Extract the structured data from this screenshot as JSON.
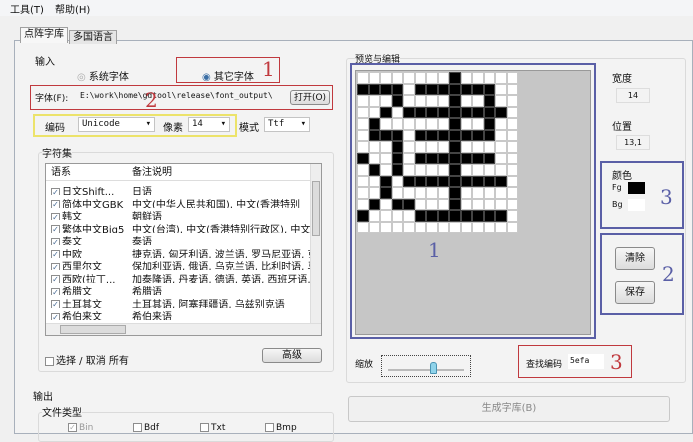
{
  "menu": {
    "tools": "工具(T)",
    "help": "帮助(H)"
  },
  "tabs": [
    "点阵字库",
    "多国语言"
  ],
  "input": {
    "title": "输入",
    "radio_system": "系统字体",
    "radio_other": "其它字体",
    "font_label": "字体(F):",
    "font_path": "E:\\work\\home\\gdtool\\release\\font_output\\",
    "open_button": "打开(O)",
    "encoding_label": "编码",
    "encoding_value": "Unicode",
    "pixel_label": "像素",
    "pixel_value": "14",
    "mode_label": "模式",
    "mode_value": "Ttf"
  },
  "charset": {
    "title": "字符集",
    "headers": [
      "语系",
      "备注说明"
    ],
    "rows": [
      [
        "日文Shift...",
        "日语"
      ],
      [
        "简体中文GBK",
        "中文(中华人民共和国), 中文(香港特别"
      ],
      [
        "韩文",
        "朝鲜语"
      ],
      [
        "繁体中文Big5",
        "中文(台湾), 中文(香港特别行政区), 中文"
      ],
      [
        "泰文",
        "泰语"
      ],
      [
        "中欧",
        "捷克语, 匈牙利语, 波兰语, 罗马尼亚语, 克"
      ],
      [
        "西里尔文",
        "保加利亚语, 俄语, 乌克兰语, 比利时语, 马"
      ],
      [
        "西欧(拉丁...",
        "加泰隆语, 丹麦语, 德语, 英语, 西班牙语, 芬"
      ],
      [
        "希腊文",
        "希腊语"
      ],
      [
        "土耳其文",
        "土耳其语, 阿塞拜疆语, 乌兹别克语"
      ],
      [
        "希伯来文",
        "希伯来语"
      ]
    ],
    "select_all": "选择 / 取消 所有",
    "advanced_button": "高级"
  },
  "output": {
    "title": "输出",
    "file_type": "文件类型",
    "types": [
      "Bin",
      "Bdf",
      "Txt",
      "Bmp"
    ]
  },
  "preview": {
    "title": "预览与编辑",
    "width_label": "宽度",
    "width_value": "14",
    "pos_label": "位置",
    "pos_value": "13,1",
    "color_label": "颜色",
    "fg": "Fg",
    "bg": "Bg",
    "fg_color": "#000000",
    "bg_color": "#ffffff",
    "clear_button": "清除",
    "save_button": "保存",
    "zoom_label": "缩放",
    "zoom_level": 0.6,
    "find_label": "查找编码",
    "find_value": "5efa",
    "generate_button": "生成字库(B)",
    "glyph": [
      "00000000100000",
      "11110111111100",
      "00010000100100",
      "00101111111110",
      "01000000100100",
      "01110111111100",
      "00010000100000",
      "10010111111100",
      "01010000100000",
      "00101111111110",
      "00100000100000",
      "01011000100000",
      "10000111111110",
      "00000000000000"
    ]
  },
  "annotations": {
    "n1": "1",
    "n2": "2",
    "n3": "3"
  }
}
